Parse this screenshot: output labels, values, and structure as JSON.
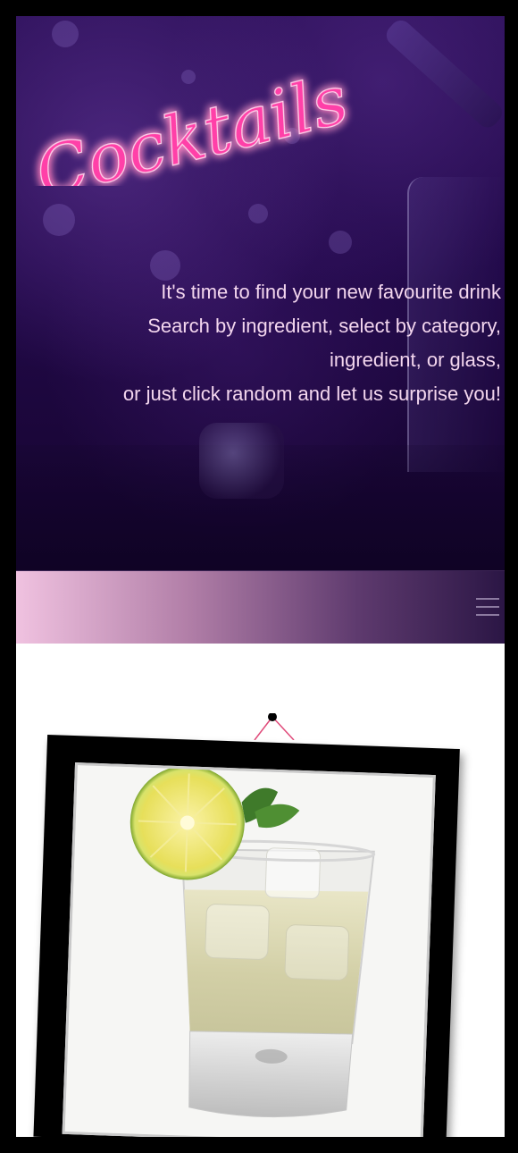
{
  "hero": {
    "logo_text": "Cocktails",
    "tagline": [
      "It's time to find your new favourite drink",
      "Search by ingredient, select by category,",
      "ingredient, or glass,",
      "or just click random and let us surprise you!"
    ]
  },
  "nav": {
    "menu_icon": "hamburger-menu-icon"
  },
  "colors": {
    "neon_pink": "#ff3fa8",
    "hero_dark": "#22094a",
    "tagline_text": "#f3d6ee",
    "frame_black": "#000000"
  },
  "featured": {
    "image_alt_icon": "cocktail-photo"
  }
}
